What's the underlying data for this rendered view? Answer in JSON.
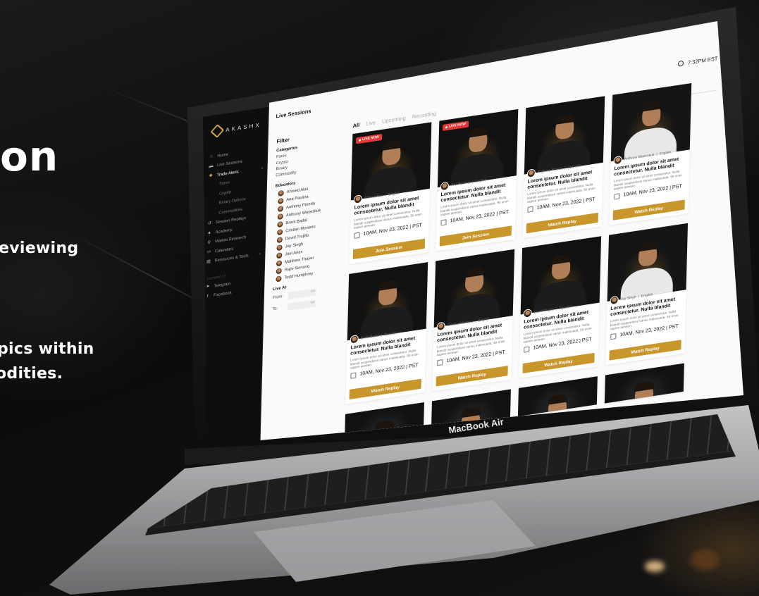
{
  "hero": {
    "big": "on",
    "line1": "eviewing",
    "line2": "pics within",
    "line3": "odities."
  },
  "laptop": {
    "label": "MacBook Air"
  },
  "app": {
    "brand": "AKASHX",
    "time": "7:32PM EST",
    "page_title": "Live Sessions",
    "nav": [
      {
        "label": "Home",
        "icon": "home-icon"
      },
      {
        "label": "Live Sessions",
        "icon": "video-icon"
      },
      {
        "label": "Trade Alerts",
        "icon": "bell-icon",
        "active": true
      },
      {
        "label": "Forex",
        "sub": true
      },
      {
        "label": "Crypto",
        "sub": true
      },
      {
        "label": "Binary Options",
        "sub": true
      },
      {
        "label": "Commodities",
        "sub": true
      },
      {
        "label": "Session Replays",
        "icon": "replay-icon"
      },
      {
        "label": "Academy",
        "icon": "graduation-icon"
      },
      {
        "label": "Market Research",
        "icon": "search-icon"
      },
      {
        "label": "Calendars",
        "icon": "calendar-icon"
      },
      {
        "label": "Resources & Tools",
        "icon": "tools-icon"
      }
    ],
    "connect_label": "CONNECT",
    "social": [
      {
        "label": "Telegram",
        "icon": "telegram-icon"
      },
      {
        "label": "Facebook",
        "icon": "facebook-icon"
      }
    ],
    "filter": {
      "title": "Filter",
      "categories_label": "Categories",
      "categories": [
        "Forex",
        "Crypto",
        "Binary",
        "Commodity"
      ],
      "educators_label": "Educators",
      "educators": [
        "Ahmed Alas",
        "Ana Paulina",
        "Anthony Pineda",
        "Anthony Waseskuk",
        "Brent Badal",
        "Cristian Montero",
        "David Trujillo",
        "Jay Singh",
        "Joel Arias",
        "Matthew Thayer",
        "Rajiv Serrano",
        "Todd Humphrey"
      ],
      "live_at_label": "Live At",
      "from_label": "From:",
      "to_label": "To:"
    },
    "tabs": [
      "All",
      "Live",
      "Upcoming",
      "Recording"
    ],
    "active_tab": "All",
    "cards": [
      {
        "educator": "Ahmed Alas",
        "lang": "English",
        "live": true,
        "light": false,
        "title": "Lorem ipsum dolor sit amet consectetur. Nulla blandit",
        "desc": "Lorem ipsum dolor sit amet consectetur. Nulla blandit suspendisse varius malesuada. Sit enim sapien aenean.",
        "date": "10AM, Nov 23, 2022 | PST",
        "button": "Join Session"
      },
      {
        "educator": "Ana Paulina",
        "lang": "English",
        "live": true,
        "light": false,
        "title": "Lorem ipsum dolor sit amet consectetur. Nulla blandit",
        "desc": "Lorem ipsum dolor sit amet consectetur. Nulla blandit suspendisse varius malesuada. Sit enim sapien aenean.",
        "date": "10AM, Nov 23, 2022 | PST",
        "button": "Join Session"
      },
      {
        "educator": "Anthony Pineda",
        "lang": "Spanish",
        "live": false,
        "light": false,
        "title": "Lorem ipsum dolor sit amet consectetur. Nulla blandit",
        "desc": "Lorem ipsum dolor sit amet consectetur. Nulla blandit suspendisse varius malesuada. Sit enim sapien aenean.",
        "date": "10AM, Nov 23, 2022 | PST",
        "button": "Watch Replay"
      },
      {
        "educator": "Anthony Waseskuk",
        "lang": "English",
        "live": false,
        "light": true,
        "title": "Lorem ipsum dolor sit amet consectetur. Nulla blandit",
        "desc": "Lorem ipsum dolor sit amet consectetur. Nulla blandit suspendisse varius malesuada. Sit enim sapien aenean.",
        "date": "10AM, Nov 23, 2022 | PST",
        "button": "Watch Replay"
      },
      {
        "educator": "Brent Badal",
        "lang": "Spanish",
        "live": false,
        "light": false,
        "title": "Lorem ipsum dolor sit amet consectetur. Nulla blandit",
        "desc": "Lorem ipsum dolor sit amet consectetur. Nulla blandit suspendisse varius malesuada. Sit enim sapien aenean.",
        "date": "10AM, Nov 23, 2022 | PST",
        "button": "Watch Replay"
      },
      {
        "educator": "Cristian Montero",
        "lang": "English",
        "live": false,
        "light": false,
        "title": "Lorem ipsum dolor sit amet consectetur. Nulla blandit",
        "desc": "Lorem ipsum dolor sit amet consectetur. Nulla blandit suspendisse varius malesuada. Sit enim sapien aenean.",
        "date": "10AM, Nov 23, 2022 | PST",
        "button": "Watch Replay"
      },
      {
        "educator": "David Trujillo",
        "lang": "Spanish",
        "live": false,
        "light": false,
        "title": "Lorem ipsum dolor sit amet consectetur. Nulla blandit",
        "desc": "Lorem ipsum dolor sit amet consectetur. Nulla blandit suspendisse varius malesuada. Sit enim sapien aenean.",
        "date": "10AM, Nov 23, 2022 | PST",
        "button": "Watch Replay"
      },
      {
        "educator": "Jay Singh",
        "lang": "English",
        "live": false,
        "light": true,
        "title": "Lorem ipsum dolor sit amet consectetur. Nulla blandit",
        "desc": "Lorem ipsum dolor sit amet consectetur. Nulla blandit suspendisse varius malesuada. Sit enim sapien aenean.",
        "date": "10AM, Nov 23, 2022 | PST",
        "button": "Watch Replay"
      }
    ],
    "colors": {
      "accent": "#c8962b",
      "live": "#e53935",
      "sidebar": "#0e0e0f"
    }
  }
}
